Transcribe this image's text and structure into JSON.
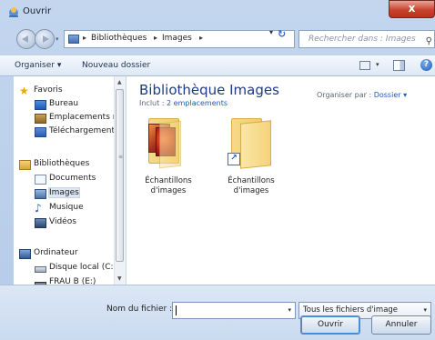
{
  "window": {
    "title": "Ouvrir",
    "close_label": "x"
  },
  "navigation": {
    "breadcrumb": [
      "Bibliothèques",
      "Images"
    ],
    "search_placeholder": "Rechercher dans : Images",
    "refresh_label": "↻"
  },
  "toolbar": {
    "organize_label": "Organiser ▾",
    "new_folder_label": "Nouveau dossier",
    "help_label": "?"
  },
  "sidebar": {
    "favorites": {
      "label": "Favoris",
      "items": [
        "Bureau",
        "Emplacements ré",
        "Téléchargements"
      ]
    },
    "libraries": {
      "label": "Bibliothèques",
      "items": [
        "Documents",
        "Images",
        "Musique",
        "Vidéos"
      ],
      "selected": "Images"
    },
    "computer": {
      "label": "Ordinateur",
      "items": [
        "Disque local (C:)",
        "FRAU B (E:)"
      ]
    }
  },
  "content": {
    "title": "Bibliothèque Images",
    "includes_label": "Inclut : ",
    "includes_link": "2 emplacements",
    "arrange_label": "Organiser par : ",
    "arrange_value": "Dossier ▾",
    "folders": [
      {
        "label": "Échantillons d'images",
        "shortcut": false
      },
      {
        "label": "Échantillons d'images",
        "shortcut": true
      }
    ]
  },
  "footer": {
    "filename_label": "Nom du fichier :",
    "filename_value": "",
    "filetype_value": "Tous les fichiers d'image",
    "open_label": "Ouvrir",
    "cancel_label": "Annuler"
  }
}
